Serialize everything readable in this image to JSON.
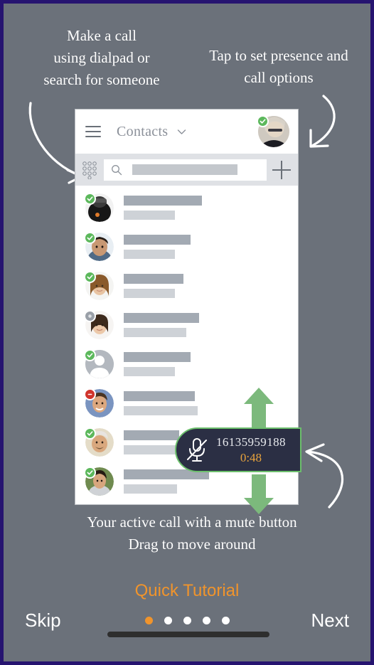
{
  "theme": {
    "background": "#6b717a",
    "border": "#261470",
    "accent_orange": "#f0942c",
    "presence_available": "#5cb85c",
    "presence_offline": "#9aa0a8",
    "presence_busy": "#d0342c",
    "call_widget_bg": "#2b2f44",
    "call_widget_border": "#6cbf6c",
    "drag_arrow": "#7cb97c"
  },
  "callouts": {
    "left": "Make a call\nusing dialpad or\nsearch for someone",
    "right": "Tap to set presence and\ncall options",
    "bottom": "Your active call with a mute button\nDrag to move around"
  },
  "app": {
    "header": {
      "menu_icon": "hamburger-icon",
      "title": "Contacts",
      "chevron_icon": "chevron-down-icon",
      "avatar_icon": "avatar",
      "avatar_presence": "available"
    },
    "search": {
      "dialpad_icon": "dialpad-icon",
      "search_icon": "search-icon",
      "placeholder": "",
      "add_icon": "plus-icon"
    },
    "contacts": [
      {
        "presence": "available",
        "avatar": "photo-1",
        "name_width": 110,
        "sub_width": 72
      },
      {
        "presence": "available",
        "avatar": "photo-2",
        "name_width": 94,
        "sub_width": 72
      },
      {
        "presence": "available",
        "avatar": "photo-3",
        "name_width": 84,
        "sub_width": 72
      },
      {
        "presence": "offline",
        "avatar": "photo-4",
        "name_width": 106,
        "sub_width": 88
      },
      {
        "presence": "available",
        "avatar": "silhouette",
        "name_width": 94,
        "sub_width": 72
      },
      {
        "presence": "busy",
        "avatar": "photo-5",
        "name_width": 100,
        "sub_width": 104
      },
      {
        "presence": "available",
        "avatar": "photo-6",
        "name_width": 78,
        "sub_width": 78
      },
      {
        "presence": "available",
        "avatar": "photo-7",
        "name_width": 120,
        "sub_width": 75
      }
    ]
  },
  "call_widget": {
    "mute_icon": "microphone-muted-icon",
    "number": "16135959188",
    "timer": "0:48",
    "drag_up_icon": "arrow-up-icon",
    "drag_down_icon": "arrow-down-icon"
  },
  "footer": {
    "tutorial_label": "Quick Tutorial",
    "skip_label": "Skip",
    "next_label": "Next",
    "dots_count": 5,
    "active_dot": 0
  }
}
